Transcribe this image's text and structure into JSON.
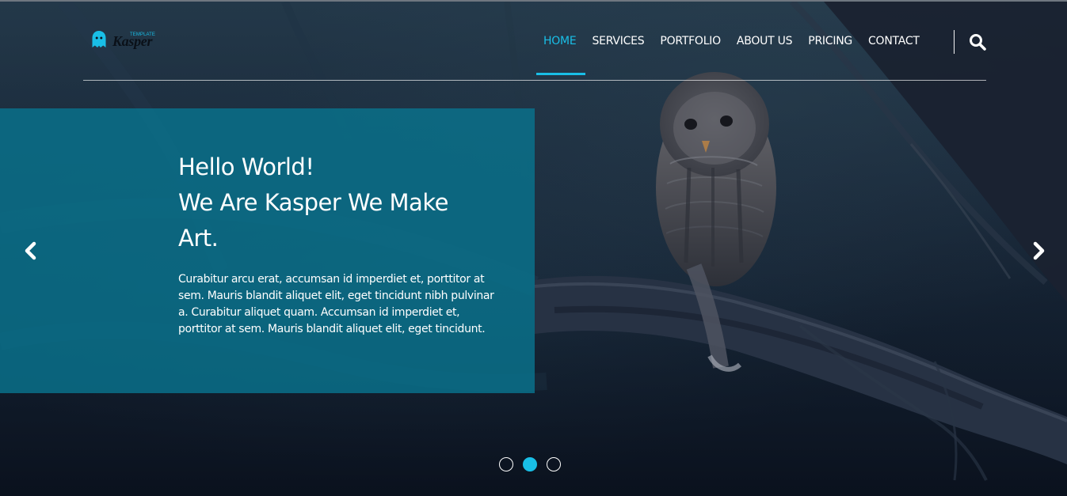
{
  "brand": {
    "logo_small_text": "TEMPLATE",
    "logo_main_text": "Kasper",
    "accent_color": "#19bfe7"
  },
  "nav": {
    "items": [
      {
        "label": "HOME",
        "active": true
      },
      {
        "label": "SERVICES",
        "active": false
      },
      {
        "label": "PORTFOLIO",
        "active": false
      },
      {
        "label": "ABOUT US",
        "active": false
      },
      {
        "label": "PRICING",
        "active": false
      },
      {
        "label": "CONTACT",
        "active": false
      }
    ],
    "search_icon": "search-icon"
  },
  "slide": {
    "title_line_1": "Hello World!",
    "title_line_2": "We Are Kasper We Make",
    "title_line_3": "Art.",
    "body": "Curabitur arcu erat, accumsan id imperdiet et, porttitor at sem. Mauris blandit aliquet elit, eget tincidunt nibh pulvinar a. Curabitur aliquet quam. Accumsan id imperdiet et, porttitor at sem. Mauris blandit aliquet elit, eget tincidunt.",
    "prev_icon": "chevron-left-icon",
    "next_icon": "chevron-right-icon",
    "total_slides": 3,
    "active_slide": 2
  }
}
